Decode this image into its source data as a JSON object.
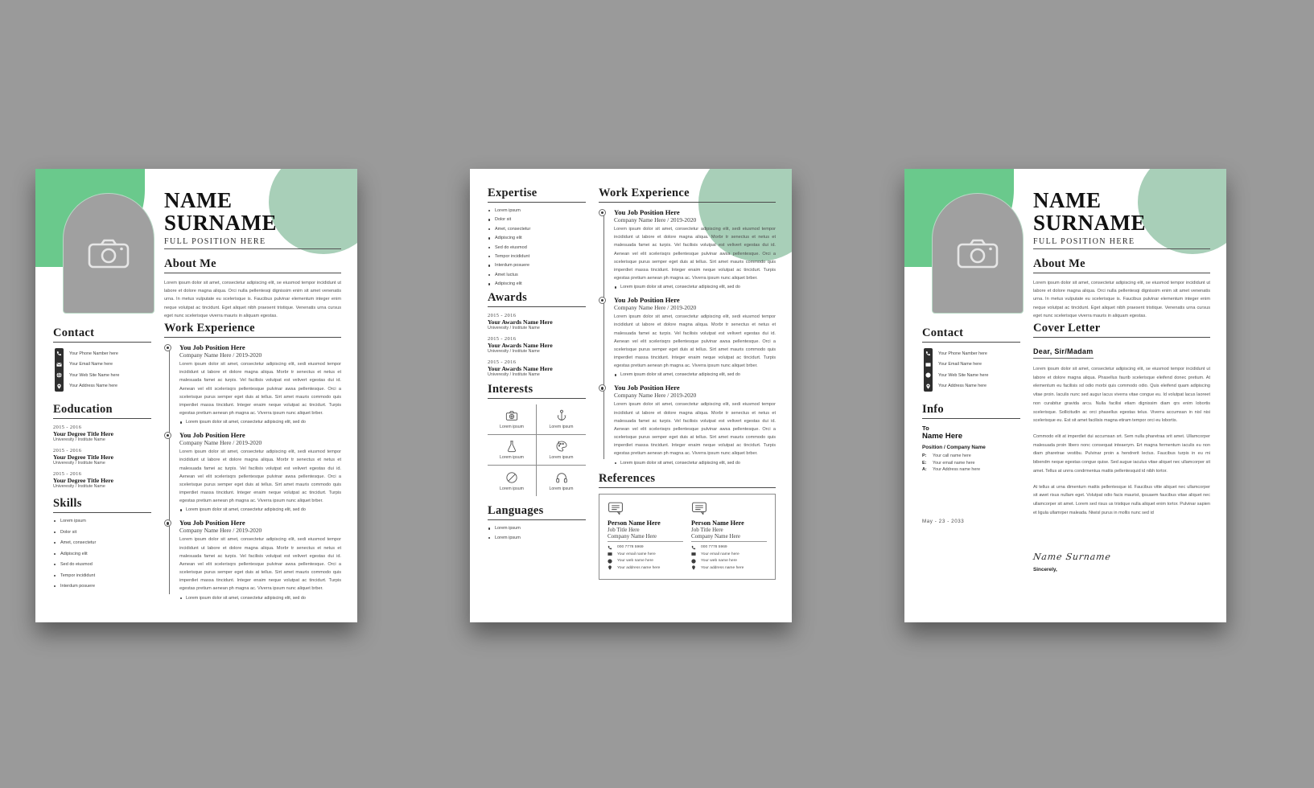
{
  "meta": {
    "accent_green_dark": "#6ac98c",
    "accent_green_light": "#a8cfb8",
    "background": "#9a9a9a"
  },
  "person": {
    "first_name": "NAME",
    "last_name": "SURNAME",
    "role": "FULL POSITION HERE",
    "signature": "Name Surname"
  },
  "headings": {
    "about": "About Me",
    "contact": "Contact",
    "education": "Eoducation",
    "skills": "Skills",
    "work": "Work Experience",
    "expertise": "Expertise",
    "awards": "Awards",
    "interests": "Interests",
    "languages": "Languages",
    "references": "References",
    "info": "Info",
    "cover_letter": "Cover Letter"
  },
  "about_text": "Lorem ipsum dolor sit amet, consectetur adipiscing elit, se eiusmod tempor incididunt ut labore et dolore magna aliqua. Orci nulla pellentesqi dignissim enim sit amet venenatis urna. In metus vulputate eu scelerisque is. Faucibus pulvinar elementum integer enim neque volutpat ac tincidunt. Eget aliquet nibh praesent tristique. Venenatis urna cursus eget nunc scelerisque viverra mauris in aliquam egestas.",
  "contact": [
    {
      "icon": "phone-icon",
      "label": "Your Phone Namber here"
    },
    {
      "icon": "email-icon",
      "label": "Your Email Name here"
    },
    {
      "icon": "globe-icon",
      "label": "Your Web Site Name here"
    },
    {
      "icon": "location-icon",
      "label": "Your Address Name here"
    }
  ],
  "education": [
    {
      "year": "2015 - 2016",
      "title": "Your Degree Title Here",
      "sub": "Univeresity / Institute Name"
    },
    {
      "year": "2015 - 2016",
      "title": "Your Degree Title Here",
      "sub": "Univeresity / Institute Name"
    },
    {
      "year": "2015 - 2016",
      "title": "Your Degree Title Here",
      "sub": "Univeresity / Institute Name"
    }
  ],
  "skills": [
    "Lorem ipsum",
    "Dolor sit",
    "Amet, consectetur",
    "Adipiscing elit",
    "Sed do eiusmod",
    "Tempor incididunt",
    "Interdum posuere"
  ],
  "expertise": [
    "Lorem ipsum",
    "Dolor sit",
    "Amet, consectetur",
    "Adipiscing elit",
    "Sed do eiusmod",
    "Tempor incididunt",
    "Interdum posuere",
    "Amet luctus",
    "Adipiscing elit"
  ],
  "awards": [
    {
      "year": "2015 - 2016",
      "title": "Your Awards Name Here",
      "sub": "Univeresity / Institute Name"
    },
    {
      "year": "2015 - 2016",
      "title": "Your Awards Name Here",
      "sub": "Univeresity / Institute Name"
    },
    {
      "year": "2015 - 2016",
      "title": "Your Awards Name Here",
      "sub": "Univeresity / Institute Name"
    }
  ],
  "interests": [
    {
      "icon": "camera-icon",
      "label": "Lorem ipsum"
    },
    {
      "icon": "anchor-icon",
      "label": "Lorem ipsum"
    },
    {
      "icon": "flask-icon",
      "label": "Lorem ipsum"
    },
    {
      "icon": "palette-icon",
      "label": "Lorem ipsum"
    },
    {
      "icon": "disc-icon",
      "label": "Lorem ipsum"
    },
    {
      "icon": "headphones-icon",
      "label": "Lorem ipsum"
    }
  ],
  "languages": [
    "Lorem ipsum",
    "Lorem ipsum"
  ],
  "work": {
    "job_title": "You Job Position Here",
    "company": "Company Name Here / 2019-2020",
    "paragraph": "Lorem ipsum dolor sit amet, consectetur adipiscing elit, sedi eiusmod tempor incididunt ut labore et dolore magna aliqua. Morbr tr senectus et netus et malesuada famei ac turpis. Vel facilisis volutpat est velivert egestas dui id. Aenean vel elit scelerisqrs pellentesque pulvinar awsa pellentesque. Orci a scelerisque purus semper eget duis at tellus. Sirt amet mauris commodo quis imperdiet massa tincidunt. Integer enaim neque volutpat ac tincidurt. Turpis egestas pretium aenean ph magna ac. Viverra ipsum nunc aliquet brber.",
    "bullet": "Lorem ipsum dolor sit amet, consectetur adipiscing elit, sed do"
  },
  "references": {
    "cards": [
      {
        "icon": "testimonial-icon",
        "name": "Person Name Here",
        "job": "Job Title Here",
        "company": "Company Name Here",
        "lines": [
          {
            "icon": "phone-icon",
            "text": "000 7778 5969"
          },
          {
            "icon": "email-icon",
            "text": "Your email name here"
          },
          {
            "icon": "globe-icon",
            "text": "Your web name here"
          },
          {
            "icon": "location-icon",
            "text": "Your address name here"
          }
        ]
      },
      {
        "icon": "testimonial-icon",
        "name": "Person Name Here",
        "job": "Job Title Here",
        "company": "Company Name Here",
        "lines": [
          {
            "icon": "phone-icon",
            "text": "000 7778 5969"
          },
          {
            "icon": "email-icon",
            "text": "Your email name here"
          },
          {
            "icon": "globe-icon",
            "text": "Your web name here"
          },
          {
            "icon": "location-icon",
            "text": "Your address name here"
          }
        ]
      }
    ]
  },
  "info": {
    "to_label": "To",
    "to_name": "Name Here",
    "position": "Position / Company Name",
    "rows": [
      {
        "key": "P:",
        "value": "Your  call name here"
      },
      {
        "key": "E:",
        "value": "Your  email name here"
      },
      {
        "key": "A:",
        "value": "Your  Address name here"
      }
    ],
    "date": "May - 23 - 2033"
  },
  "cover_letter": {
    "salutation": "Dear, Sir/Madam",
    "p1": "Lorem ipsum dolor sit amet, consectetur adipiscing elit, se eiusmod tempor incididunt ut labore et dolore magna aliqua. Phasellus faurib scelerisque eleifend donec pretium. At elementum eu facilisis sd odio morbi quis commodo odio. Quis eleifend quam adipiscing vitae proin. Iaculis nunc sed augur lacus viverra vitae congue eu. Id volutpat lacus laoreet non curabitur gravida arcu. Nulla facilisi etiam dignissim diam qrs enim lobortis scelerisque. Sollicitudin ac orci phasellus egestas telus. Viverra accumsan in nisl nisi scelerisque eu. Est sit amet facilisis magna etiram tempor orci eu lobortis.",
    "p2": "Commodo elit at imperdiet dui accumsan srt. Sem nulla pharetraa srit amet. Ullamcorper malesuada proin libero nonc consequat inteaerym. Ert magna fermentum iaculis eu non diam pharetrae vestibu. Pulvinar proin a hendrerit lectus. Faucibus turpis in eu mi bibendm neque egestas congue quise. Sed augue iaculus vitae aliquet nec ullamcorper sit amet. Tellus at unrra condrmentua mattis pellentesquid id nibh tortor.",
    "p3": "At tellus at urna dimentum mattis pellentesque id. Faucibus vitte aliquet nec ullamcorper sit awet risus nullam eget. Volutpat odio facis maurist, ipsuaem faucibus vitae aliquet nec ullamcorper sit amet. Lorem sed risus us tristique nulla aliquet enim tortor. Pulvinar sapien et ligula ullamrper maleada. Niwisl purus in mollis nunc sed id",
    "sincerely": "Sincerely,"
  }
}
